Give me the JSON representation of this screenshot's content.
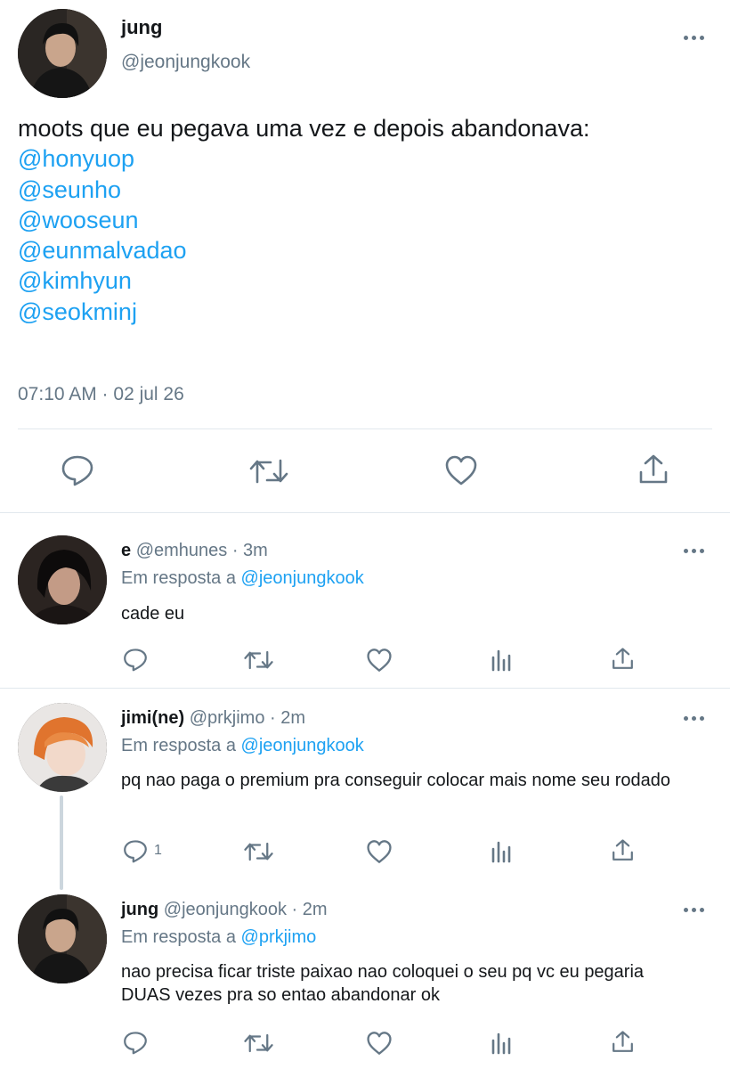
{
  "main_tweet": {
    "name": "jung",
    "handle": "@jeonjungkook",
    "text_intro": "moots que eu pegava uma vez e depois abandonava:",
    "mentions": [
      "@honyuop",
      "@seunho",
      "@wooseun",
      "@eunmalvadao",
      "@kimhyun",
      "@seokminj"
    ],
    "timestamp": "07:10 AM · 02 jul 26",
    "actions": [
      "reply-icon",
      "retweet-icon",
      "like-icon",
      "share-icon"
    ]
  },
  "replies": [
    {
      "name": "e",
      "handle": "@emhunes",
      "time": "· 3m",
      "reply_prefix": "Em resposta a",
      "reply_to": "@jeonjungkook",
      "text": "cade eu",
      "reply_count": ""
    },
    {
      "name": "jimi(ne)",
      "handle": "@prkjimo",
      "time": "· 2m",
      "reply_prefix": "Em resposta a",
      "reply_to": "@jeonjungkook",
      "text": "pq nao paga o premium pra conseguir colocar mais nome seu rodado",
      "reply_count": "1"
    },
    {
      "name": "jung",
      "handle": "@jeonjungkook",
      "time": "· 2m",
      "reply_prefix": "Em resposta a",
      "reply_to": "@prkjimo",
      "text": "nao precisa ficar triste paixao nao coloquei o seu pq vc eu pegaria DUAS vezes pra so entao abandonar ok",
      "reply_count": ""
    }
  ],
  "colors": {
    "link": "#1da1f2",
    "secondary_text": "#657786",
    "divider": "#e1e8ed",
    "thread_line": "#ccd6dd"
  }
}
